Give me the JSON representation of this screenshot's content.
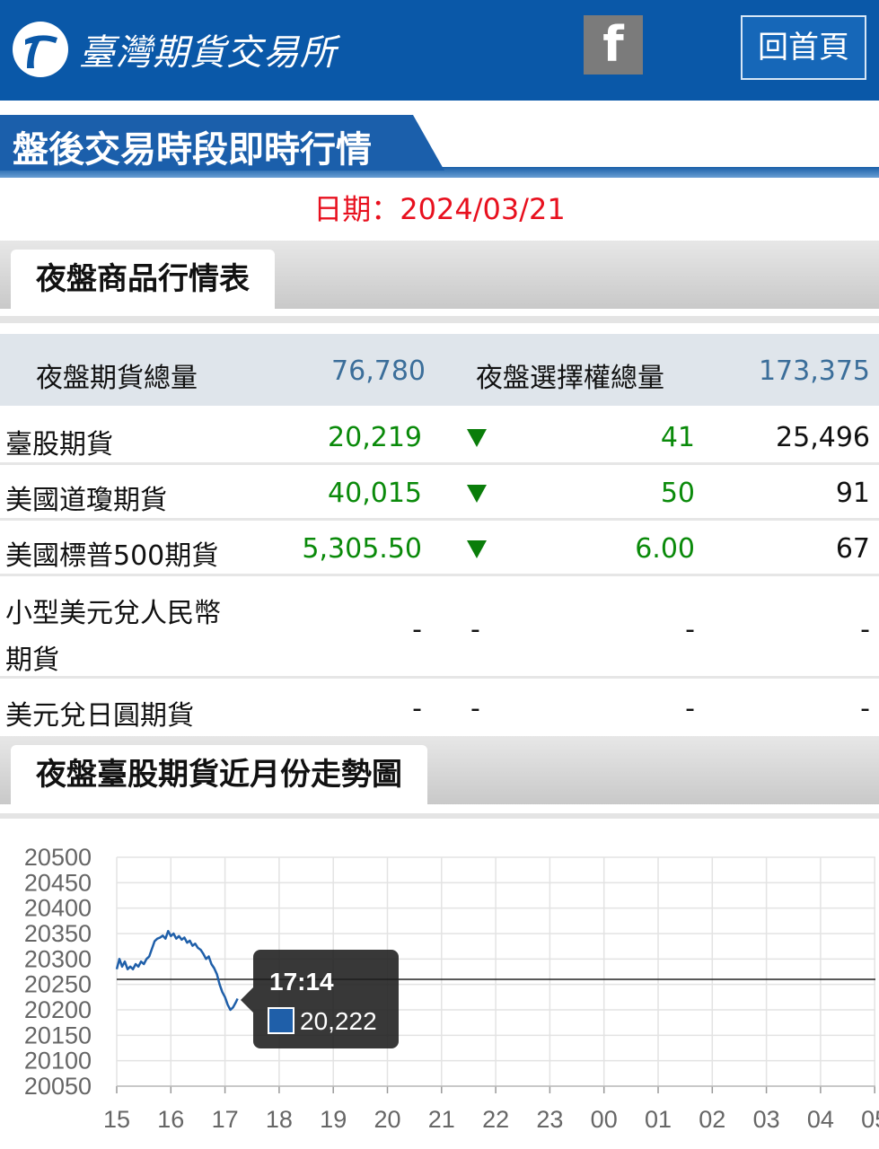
{
  "header": {
    "org_name": "臺灣期貨交易所",
    "facebook_label": "f",
    "home_label": "回首頁",
    "colors": {
      "bar": "#0a58a8",
      "fb": "#7b7b7b"
    }
  },
  "page": {
    "title": "盤後交易時段即時行情",
    "date_text": "日期：2024/03/21"
  },
  "quotes_section": {
    "title": "夜盤商品行情表",
    "summary": {
      "futures_label": "夜盤期貨總量",
      "futures_total": "76,780",
      "options_label": "夜盤選擇權總量",
      "options_total": "173,375"
    },
    "rows": [
      {
        "name": "臺股期貨",
        "price": "20,219",
        "direction": "down",
        "change": "41",
        "volume": "25,496"
      },
      {
        "name": "美國道瓊期貨",
        "price": "40,015",
        "direction": "down",
        "change": "50",
        "volume": "91"
      },
      {
        "name": "美國標普500期貨",
        "price": "5,305.50",
        "direction": "down",
        "change": "6.00",
        "volume": "67"
      },
      {
        "name_line1": "小型美元兌人民幣",
        "name_line2": "期貨",
        "price": "-",
        "direction_text": "-",
        "change": "-",
        "volume": "-"
      },
      {
        "name": "美元兌日圓期貨",
        "price": "-",
        "direction_text": "-",
        "change": "-",
        "volume": "-"
      }
    ]
  },
  "chart_section": {
    "title": "夜盤臺股期貨近月份走勢圖"
  },
  "chart_data": {
    "type": "line",
    "title": "",
    "xlabel": "",
    "ylabel": "",
    "x_ticks": [
      "15",
      "16",
      "17",
      "18",
      "19",
      "20",
      "21",
      "22",
      "23",
      "00",
      "01",
      "02",
      "03",
      "04",
      "05"
    ],
    "y_ticks": [
      20500,
      20450,
      20400,
      20350,
      20300,
      20250,
      20200,
      20150,
      20100,
      20050
    ],
    "ylim": [
      20050,
      20500
    ],
    "grid": true,
    "reference_value": 20260,
    "series": [
      {
        "color": "#1f5fa9",
        "x": [
          15.0,
          15.05,
          15.1,
          15.15,
          15.2,
          15.25,
          15.3,
          15.35,
          15.4,
          15.45,
          15.5,
          15.55,
          15.6,
          15.65,
          15.7,
          15.75,
          15.8,
          15.85,
          15.9,
          15.95,
          16.0,
          16.05,
          16.1,
          16.15,
          16.2,
          16.25,
          16.3,
          16.35,
          16.4,
          16.45,
          16.5,
          16.55,
          16.6,
          16.65,
          16.7,
          16.75,
          16.8,
          16.85,
          16.9,
          16.95,
          17.0,
          17.05,
          17.1,
          17.15,
          17.2,
          17.233
        ],
        "values": [
          20280,
          20300,
          20285,
          20295,
          20280,
          20285,
          20280,
          20290,
          20285,
          20295,
          20290,
          20300,
          20305,
          20320,
          20335,
          20340,
          20342,
          20346,
          20340,
          20355,
          20345,
          20350,
          20340,
          20345,
          20338,
          20342,
          20332,
          20336,
          20326,
          20330,
          20322,
          20318,
          20310,
          20300,
          20305,
          20290,
          20282,
          20270,
          20250,
          20235,
          20225,
          20210,
          20200,
          20205,
          20215,
          20222
        ]
      }
    ],
    "tooltip": {
      "time": "17:14",
      "value": "20,222"
    }
  }
}
